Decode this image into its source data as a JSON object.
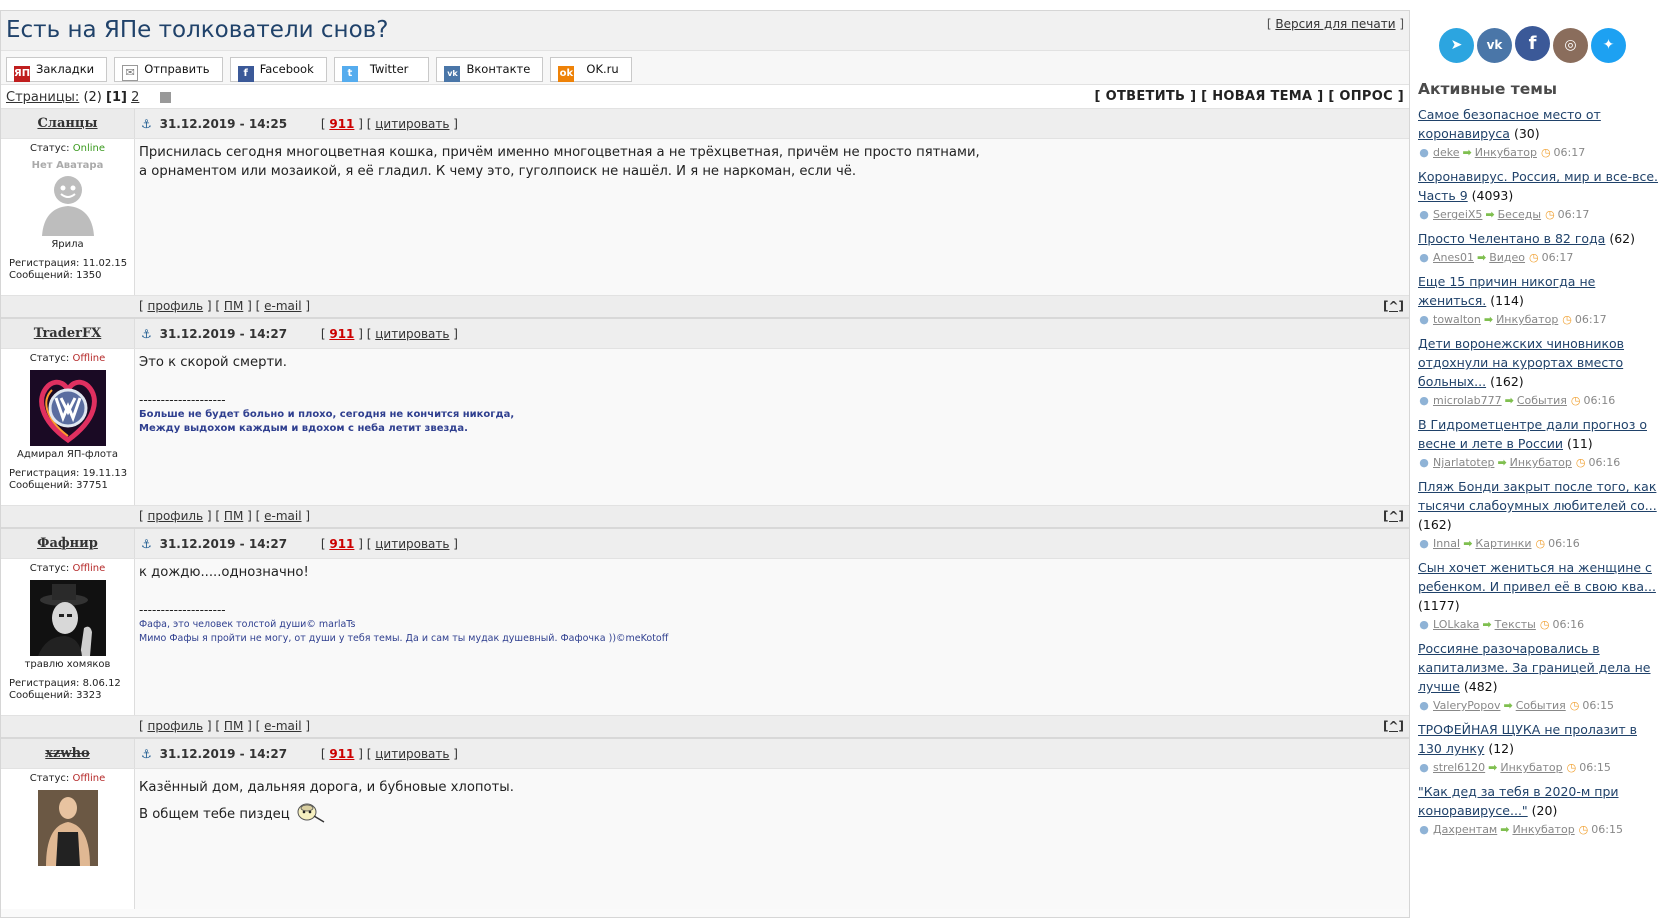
{
  "topic": {
    "title": "Есть на ЯПе толкователи снов?",
    "print_link": "Версия для печати"
  },
  "share": [
    {
      "id": "bookmarks",
      "label": "Закладки",
      "icon": "yap-icon",
      "color": "#c01e1e"
    },
    {
      "id": "send",
      "label": "Отправить",
      "icon": "mail-icon",
      "color": "#777777"
    },
    {
      "id": "facebook",
      "label": "Facebook",
      "icon": "facebook-icon",
      "color": "#3b5998"
    },
    {
      "id": "twitter",
      "label": "Twitter",
      "icon": "twitter-icon",
      "color": "#55acee"
    },
    {
      "id": "vkontakte",
      "label": "Вконтакте",
      "icon": "vk-icon",
      "color": "#4a76a8"
    },
    {
      "id": "okru",
      "label": "OK.ru",
      "icon": "ok-icon",
      "color": "#ee8208"
    }
  ],
  "pages": {
    "label": "Страницы:",
    "total": "(2)",
    "current": "[1]",
    "next": "2",
    "actions": [
      "[ ОТВЕТИТЬ ]",
      "[ НОВАЯ ТЕМА ]",
      "[ ОПРОС ]"
    ]
  },
  "post_labels": {
    "status": "Статус:",
    "reg": "Регистрация:",
    "msgs": "Сообщений:",
    "num": "911",
    "quote": "цитировать",
    "profile": "профиль",
    "pm": "ПМ",
    "email": "e-mail",
    "up": "[^]",
    "no_avatar": "Нет Аватара"
  },
  "posts": [
    {
      "author": "Сланцы",
      "status": "Online",
      "rank": "Ярила",
      "reg": "11.02.15",
      "msgs": "1350",
      "date": "31.12.2019 - 14:25",
      "text": [
        "Приснилась сегодня многоцветная кошка, причём именно многоцветная а не трёхцветная, причём не просто пятнами,",
        "а орнаментом или мозаикой, я её гладил. К чему это, гуголпоиск не нашёл. И я не наркоман, если чё."
      ],
      "signature": []
    },
    {
      "author": "TraderFX",
      "status": "Offline",
      "rank": "Адмирал ЯП-флота",
      "reg": "19.11.13",
      "msgs": "37751",
      "date": "31.12.2019 - 14:27",
      "text": [
        "Это к скорой смерти."
      ],
      "signature": [
        "Больше не будет больно и плохо, сегодня не кончится никогда,",
        "Между выдохом каждым и вдохом с неба летит звезда."
      ]
    },
    {
      "author": "Фафнир",
      "status": "Offline",
      "rank": "травлю хомяков",
      "reg": "8.06.12",
      "msgs": "3323",
      "date": "31.12.2019 - 14:27",
      "text": [
        "к дождю.....однозначно!"
      ],
      "signature": [
        "Фафа, это человек толстой души© marlaTs",
        "Мимо Фафы я пройти не могу, от души у тебя темы. Да и сам ты мудак душевный. Фафочка ))©meKotoff"
      ]
    },
    {
      "author": "xzwho",
      "status": "Offline",
      "date": "31.12.2019 - 14:27",
      "text": [
        "Казённый дом, дальняя дорога, и бубновые хлопоты.",
        "В общем тебе пиздец"
      ]
    }
  ],
  "sig_sep": "--------------------",
  "sidebar": {
    "socials": [
      {
        "name": "telegram-icon",
        "glyph": "➤",
        "color": "#2ca5e0"
      },
      {
        "name": "vk-icon",
        "glyph": "vk",
        "color": "#4a76a8"
      },
      {
        "name": "facebook-icon",
        "glyph": "f",
        "color": "#3b5998"
      },
      {
        "name": "instagram-icon",
        "glyph": "◎",
        "color": "#8a6d5c"
      },
      {
        "name": "twitter-icon",
        "glyph": "✦",
        "color": "#1da1f2"
      }
    ],
    "title": "Активные темы",
    "topics": [
      {
        "title": "Самое безопасное место от коронавируса",
        "count": "(30)",
        "user": "deke",
        "forum": "Инкубатор",
        "time": "06:17"
      },
      {
        "title": "Коронавирус. Россия, мир и все-все. Часть 9",
        "count": "(4093)",
        "user": "SergeiX5",
        "forum": "Беседы",
        "time": "06:17"
      },
      {
        "title": "Просто Челентано в 82 года",
        "count": "(62)",
        "user": "Anes01",
        "forum": "Видео",
        "time": "06:17"
      },
      {
        "title": "Еще 15 причин никогда не жениться.",
        "count": "(114)",
        "user": "towalton",
        "forum": "Инкубатор",
        "time": "06:17"
      },
      {
        "title": "Дети воронежских чиновников отдохнули на курортах вместо больных...",
        "count": "(162)",
        "user": "microlab777",
        "forum": "События",
        "time": "06:16"
      },
      {
        "title": "В Гидрометцентре дали прогноз о весне и лете в России",
        "count": "(11)",
        "user": "Njarlatotep",
        "forum": "Инкубатор",
        "time": "06:16"
      },
      {
        "title": "Пляж Бонди закрыт после того, как тысячи слабоумных любителей со...",
        "count": "(162)",
        "user": "InnaI",
        "forum": "Картинки",
        "time": "06:16"
      },
      {
        "title": "Сын хочет жениться на женщине с ребенком. И привел её в свою ква...",
        "count": "(1177)",
        "user": "LOLkaka",
        "forum": "Тексты",
        "time": "06:16"
      },
      {
        "title": "Россияне разочаровались в капитализме. За границей дела не лучше",
        "count": "(482)",
        "user": "ValeryPopov",
        "forum": "События",
        "time": "06:15"
      },
      {
        "title": "ТРОФЕЙНАЯ ЩУКА не пролазит в 130 лунку",
        "count": "(12)",
        "user": "strel6120",
        "forum": "Инкубатор",
        "time": "06:15"
      },
      {
        "title": "\"Как дед за тебя в 2020-м при коноравирусе...\"",
        "count": "(20)",
        "user": "Дахрентам",
        "forum": "Инкубатор",
        "time": "06:15"
      }
    ]
  }
}
